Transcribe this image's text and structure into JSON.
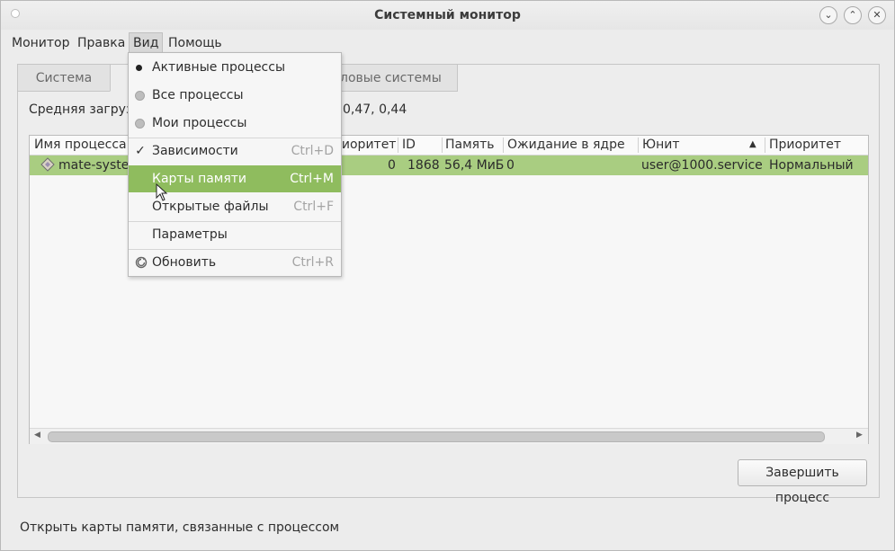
{
  "window": {
    "title": "Системный монитор"
  },
  "menubar": {
    "items": [
      "Монитор",
      "Правка",
      "Вид",
      "Помощь"
    ]
  },
  "tabs": {
    "system": "Система",
    "processes": "",
    "filesystems": "Файловые системы",
    "filesystems_visible": "ловые системы"
  },
  "load": {
    "label": "Средняя загрузк",
    "values": "0,47, 0,44"
  },
  "table": {
    "headers": [
      "Имя процесса",
      "риоритет",
      "ID",
      "Память",
      "Ожидание в ядре",
      "Юнит",
      "Приоритет"
    ],
    "sort_column": "Юнит",
    "rows": [
      {
        "name": "mate-syster",
        "nice": "0",
        "id": "1868",
        "memory": "56,4 МиБ",
        "wait": "0",
        "unit": "user@1000.service",
        "priority": "Нормальный"
      }
    ]
  },
  "buttons": {
    "end_process": "Завершить процесс"
  },
  "status": {
    "text": "Открыть карты памяти, связанные с процессом"
  },
  "view_menu": {
    "items": [
      {
        "label": "Активные процессы",
        "accel": "",
        "mark": "radio-selected"
      },
      {
        "label": "Все процессы",
        "accel": "",
        "mark": "radio"
      },
      {
        "label": "Мои процессы",
        "accel": "",
        "mark": "radio"
      },
      {
        "label": "Зависимости",
        "accel": "Ctrl+D",
        "mark": "check"
      },
      {
        "label": "Карты памяти",
        "accel": "Ctrl+M",
        "mark": "none"
      },
      {
        "label": "Открытые файлы",
        "accel": "Ctrl+F",
        "mark": "none"
      },
      {
        "label": "Параметры",
        "accel": "",
        "mark": "none"
      },
      {
        "label": "Обновить",
        "accel": "Ctrl+R",
        "mark": "refresh-icon"
      }
    ],
    "highlighted": "Карты памяти"
  },
  "colors": {
    "selection": "#a9cd81",
    "menu_highlight": "#8fbc5e"
  }
}
